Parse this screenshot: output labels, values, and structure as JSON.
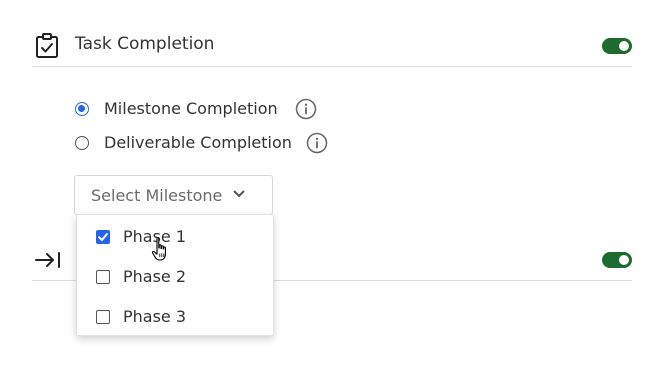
{
  "task_section": {
    "title": "Task Completion",
    "icon": "clipboard-check-icon",
    "toggle_on": true
  },
  "completion_options": [
    {
      "label": "Milestone Completion",
      "selected": true
    },
    {
      "label": "Deliverable Completion",
      "selected": false
    }
  ],
  "milestone_select": {
    "label": "Select Milestone",
    "expanded": true,
    "options": [
      {
        "label": "Phase 1",
        "checked": true
      },
      {
        "label": "Phase 2",
        "checked": false
      },
      {
        "label": "Phase 3",
        "checked": false
      }
    ]
  },
  "second_section": {
    "icon": "arrow-right-to-line-icon",
    "toggle_on": true
  },
  "colors": {
    "accent": "#2563eb",
    "toggle_on": "#1e6b2f",
    "text": "#333333",
    "placeholder": "#6b6b6b",
    "divider": "#dcdcdc"
  }
}
